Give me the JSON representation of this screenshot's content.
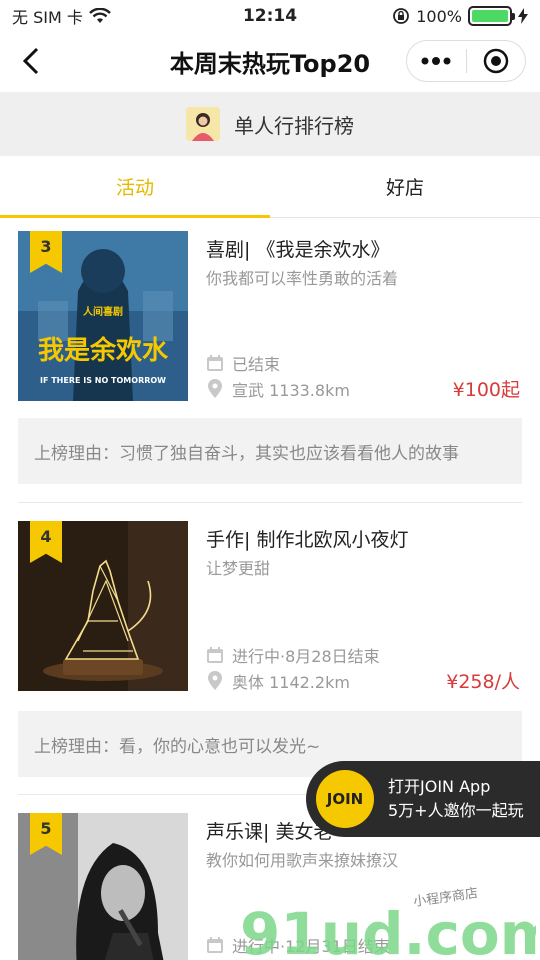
{
  "status_bar": {
    "carrier": "无 SIM 卡",
    "time": "12:14",
    "battery": "100%",
    "battery_level": 1.0
  },
  "nav": {
    "title": "本周末热玩Top20"
  },
  "banner": {
    "text": "单人行排行榜"
  },
  "tabs": [
    {
      "label": "活动",
      "active": true
    },
    {
      "label": "好店",
      "active": false
    }
  ],
  "items": [
    {
      "rank": "3",
      "title": "喜剧| 《我是余欢水》",
      "subtitle": "你我都可以率性勇敢的活着",
      "status": "已结束",
      "location": "宣武 1133.8km",
      "price": "¥100起",
      "reason": "上榜理由：习惯了独自奋斗，其实也应该看看他人的故事",
      "poster": {
        "top_text": "人间喜剧",
        "main_text": "我是余欢水",
        "bottom_text": "IF THERE IS NO TOMORROW"
      }
    },
    {
      "rank": "4",
      "title": "手作| 制作北欧风小夜灯",
      "subtitle": "让梦更甜",
      "status": "进行中·8月28日结束",
      "location": "奥体 1142.2km",
      "price": "¥258/人",
      "reason": "上榜理由：看，你的心意也可以发光~"
    },
    {
      "rank": "5",
      "title": "声乐课| 美女老",
      "subtitle": "教你如何用歌声来撩妹撩汉",
      "status": "进行中·12月31日结束",
      "location": "",
      "price": ""
    }
  ],
  "promo": {
    "logo": "JOIN",
    "line1": "打开JOIN App",
    "line2": "5万+人邀你一起玩"
  },
  "watermark": {
    "main": "91ud.com",
    "sub": "小程序商店"
  },
  "colors": {
    "accent": "#f5c800",
    "price": "#d83b3b",
    "muted": "#999999"
  }
}
